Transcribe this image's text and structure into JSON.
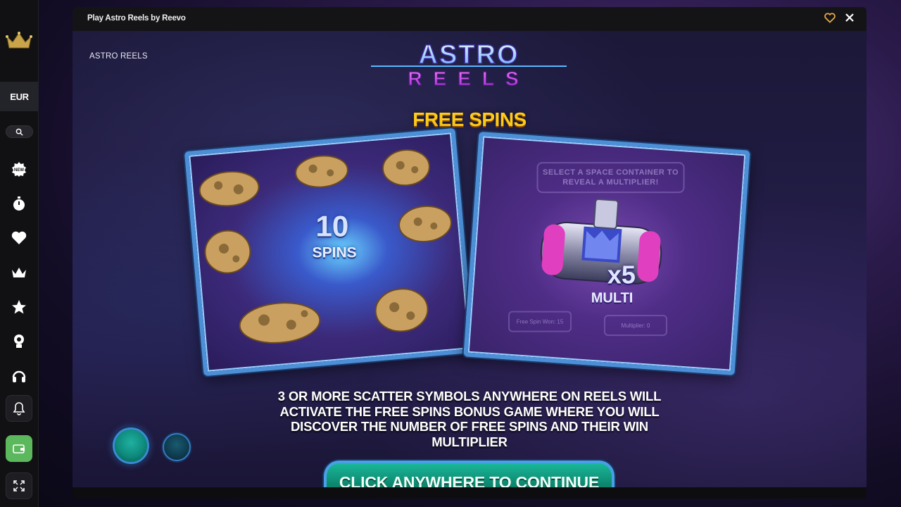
{
  "sidebar": {
    "logo_icon": "crown-logo-icon",
    "currency": "EUR",
    "search_icon": "search-icon",
    "nav_icons": [
      "new-badge-icon",
      "stopwatch-icon",
      "heart-icon",
      "crown-icon",
      "star-icon",
      "trophy-icon",
      "headset-icon"
    ],
    "bell_icon": "bell-icon",
    "wallet_icon": "wallet-icon",
    "expand_icon": "expand-icon",
    "wallet_color": "#5cb85c"
  },
  "window": {
    "title": "Play Astro Reels by Reevo",
    "favorite_icon": "heart-outline-icon",
    "close_icon": "close-icon",
    "favorite_color": "#e8a848"
  },
  "game": {
    "label": "ASTRO REELS",
    "logo_line1": "ASTRO",
    "logo_line2": "REELS",
    "heading": "FREE SPINS",
    "heading_color": "#ffcc1a",
    "left_panel": {
      "number": "10",
      "word": "SPINS"
    },
    "right_panel": {
      "sign": "SELECT A SPACE CONTAINER TO REVEAL A MULTIPLIER!",
      "multiplier": "x5",
      "word": "MULTI",
      "mini_left": "Free Spin Won: 15",
      "mini_right": "Multiplier: 0"
    },
    "description": "3 OR MORE SCATTER SYMBOLS ANYWHERE ON REELS WILL ACTIVATE THE FREE SPINS BONUS GAME WHERE YOU WILL DISCOVER THE NUMBER OF FREE SPINS AND THEIR WIN MULTIPLIER",
    "continue_label": "CLICK ANYWHERE TO CONTINUE",
    "pagination": {
      "current": 1,
      "total": 2
    }
  }
}
